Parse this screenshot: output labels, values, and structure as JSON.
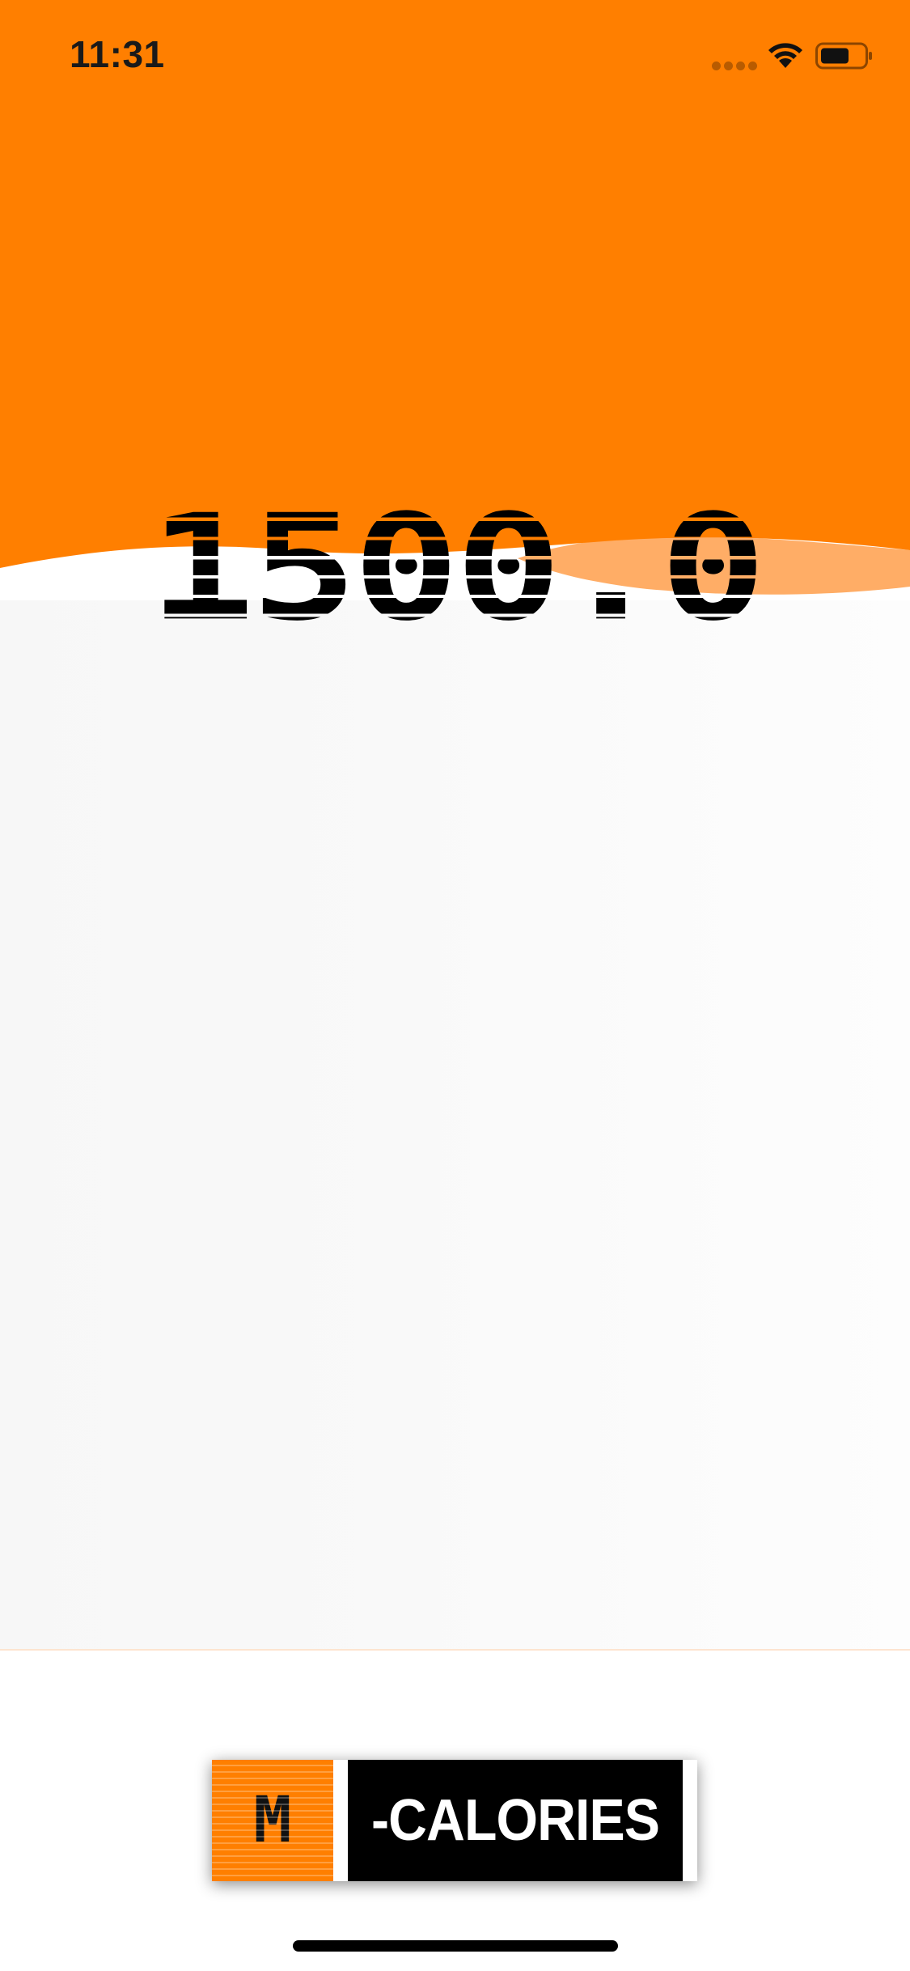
{
  "status_bar": {
    "time": "11:31"
  },
  "calorie_counter": {
    "value": "1500.0"
  },
  "brand": {
    "badge_letter": "M",
    "name": "-CALORIES"
  },
  "colors": {
    "accent": "#ff7f00",
    "accent_light": "#ffad66",
    "background": "#ffffff",
    "panel": "#f8f8f8",
    "text": "#000000"
  },
  "icons": {
    "cellular": "cellular-signal-icon",
    "wifi": "wifi-icon",
    "battery": "battery-icon"
  }
}
